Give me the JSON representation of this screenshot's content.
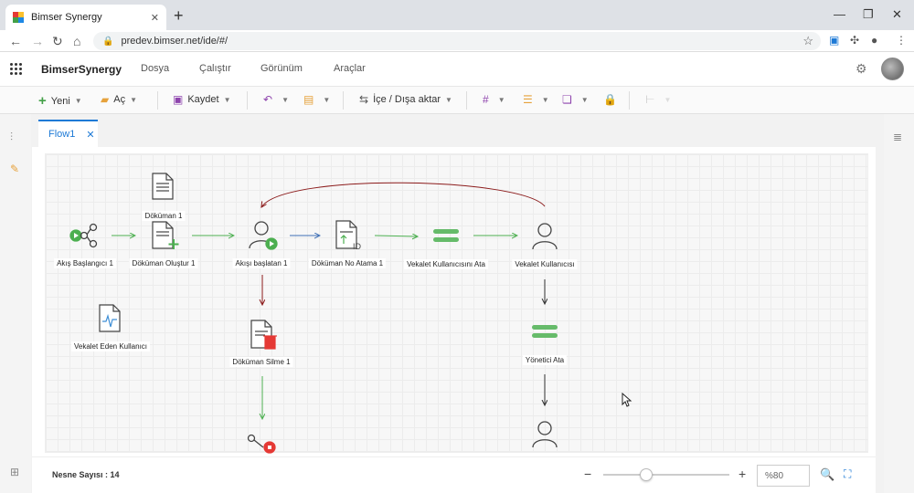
{
  "browser": {
    "tab_title": "Bimser Synergy",
    "tab_close": "✕",
    "new_tab": "+",
    "url": "predev.bimser.net/ide/#/",
    "window_controls": [
      "—",
      "❐",
      "✕"
    ]
  },
  "app": {
    "brand": "BimserSynergy",
    "menu": [
      "Dosya",
      "Çalıştır",
      "Görünüm",
      "Araçlar"
    ]
  },
  "toolbar": {
    "new_label": "Yeni",
    "open_label": "Aç",
    "save_label": "Kaydet",
    "import_export_label": "İçe / Dışa aktar"
  },
  "document_tab": {
    "label": "Flow1",
    "close": "✕"
  },
  "nodes": [
    {
      "id": "start",
      "label": "Akış Başlangıcı 1",
      "icon": "start-share-icon"
    },
    {
      "id": "doc",
      "label": "Döküman 1",
      "icon": "document-icon"
    },
    {
      "id": "doccreate",
      "label": "Döküman Oluştur 1",
      "icon": "document-add-icon"
    },
    {
      "id": "starter",
      "label": "Akışı başlatan 1",
      "icon": "user-start-icon"
    },
    {
      "id": "docno",
      "label": "Döküman No Atama 1",
      "icon": "document-id-icon"
    },
    {
      "id": "assign",
      "label": "Vekalet Kullanıcısını Ata",
      "icon": "assign-icon"
    },
    {
      "id": "proxyuser",
      "label": "Vekalet Kullanıcısı",
      "icon": "user-icon"
    },
    {
      "id": "proxygiver",
      "label": "Vekalet Eden Kullanıcı",
      "icon": "document-wave-icon"
    },
    {
      "id": "docdelete",
      "label": "Döküman Silme 1",
      "icon": "document-delete-icon"
    },
    {
      "id": "manager",
      "label": "Yönetici Ata",
      "icon": "assign-icon"
    }
  ],
  "status": {
    "object_count": "Nesne Sayısı : 14",
    "zoom_minus": "−",
    "zoom_plus": "+",
    "zoom": "%80"
  },
  "colors": {
    "accent": "#1e7ad6",
    "green_arrow": "#4caf50",
    "blue_arrow": "#3f6fb5",
    "red_arrow": "#8b1a1a",
    "start_green": "#4caf50",
    "end_red": "#e53935"
  }
}
